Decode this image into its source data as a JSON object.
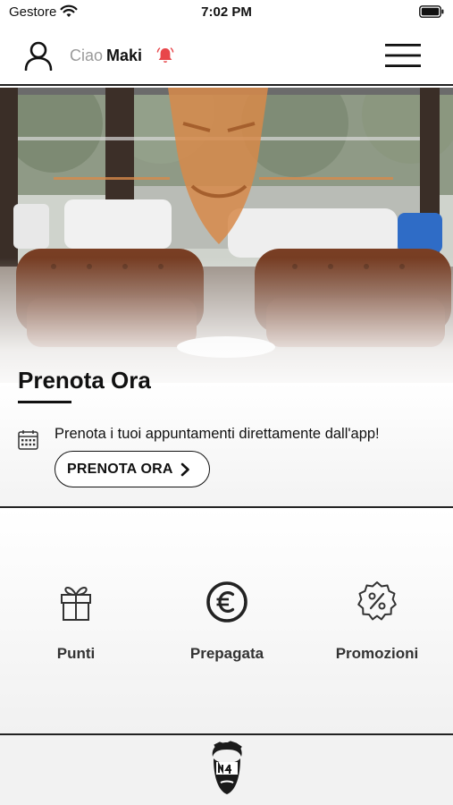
{
  "status_bar": {
    "carrier": "Gestore",
    "time": "7:02 PM",
    "icons": [
      "wifi-icon",
      "battery-icon"
    ]
  },
  "header": {
    "greeting_prefix": "Ciao",
    "user_name": "Maki",
    "icons": [
      "user-icon",
      "bell-icon",
      "hamburger-menu-icon"
    ],
    "bell_color": "#e8464a"
  },
  "booking": {
    "title": "Prenota Ora",
    "description": "Prenota i tuoi appuntamenti direttamente dall'app!",
    "button_label": "PRENOTA ORA",
    "icons": [
      "calendar-icon",
      "chevron-right-icon"
    ]
  },
  "quick_actions": [
    {
      "label": "Punti",
      "icon": "gift-icon"
    },
    {
      "label": "Prepagata",
      "icon": "euro-icon"
    },
    {
      "label": "Promozioni",
      "icon": "discount-badge-icon"
    }
  ],
  "bottom_bar": {
    "logo_icon": "barber-logo-icon"
  },
  "colors": {
    "accent_orange": "#d78a4a",
    "text_dark": "#111111",
    "divider": "#222222"
  }
}
